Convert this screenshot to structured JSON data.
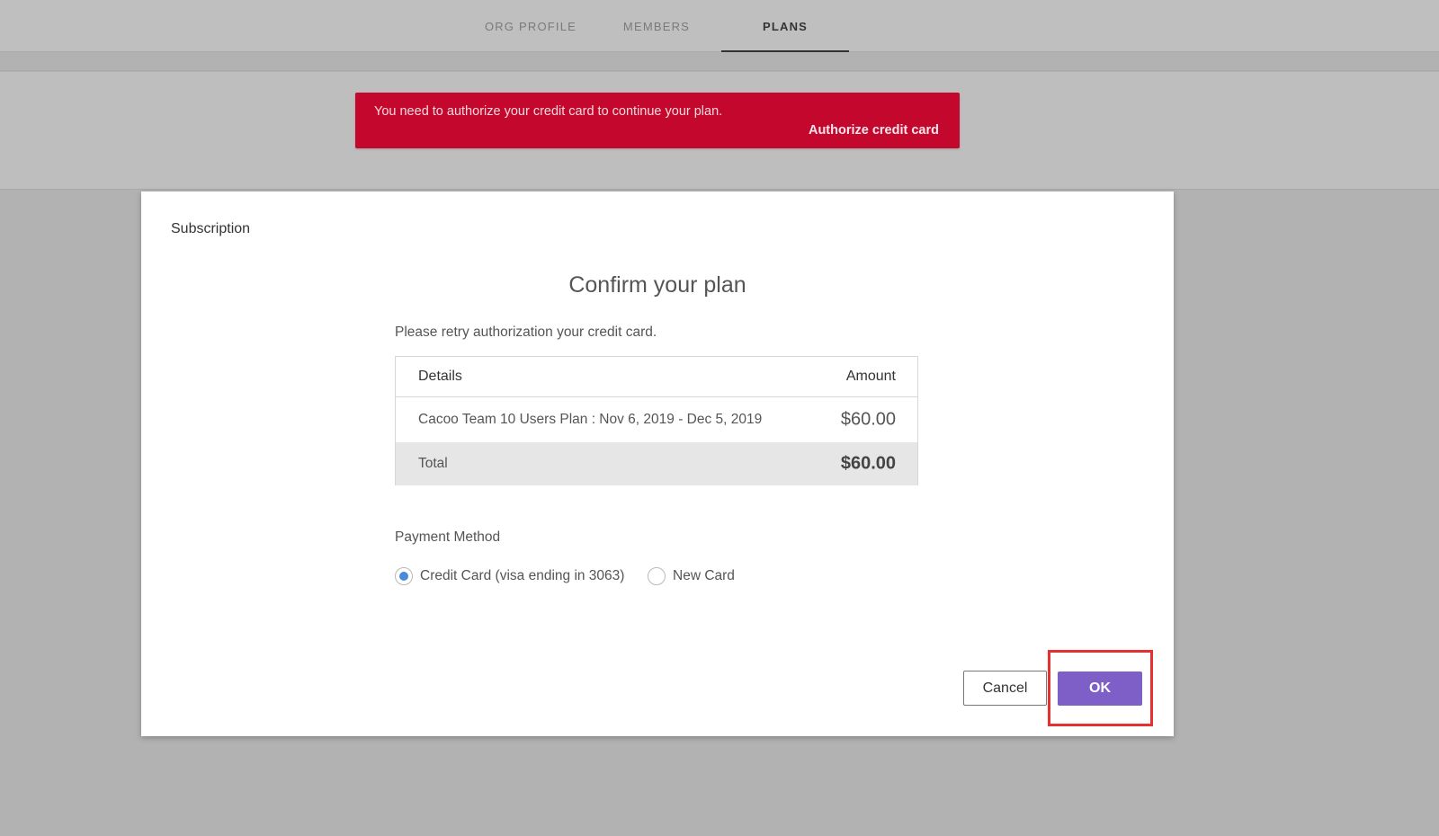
{
  "tabs": [
    {
      "label": "ORG PROFILE",
      "active": false
    },
    {
      "label": "MEMBERS",
      "active": false
    },
    {
      "label": "PLANS",
      "active": true
    }
  ],
  "alert": {
    "message": "You need to authorize your credit card to continue your plan.",
    "action_label": "Authorize credit card",
    "color": "#c4082d"
  },
  "modal": {
    "title": "Subscription",
    "heading": "Confirm your plan",
    "note": "Please retry authorization your credit card.",
    "table": {
      "header": {
        "details": "Details",
        "amount": "Amount"
      },
      "item": {
        "details": "Cacoo Team 10 Users Plan : Nov 6, 2019 - Dec 5, 2019",
        "amount": "$60.00"
      },
      "total": {
        "label": "Total",
        "amount": "$60.00"
      }
    },
    "payment_method": {
      "label": "Payment Method",
      "options": [
        {
          "label": "Credit Card (visa ending in 3063)",
          "selected": true
        },
        {
          "label": "New Card",
          "selected": false
        }
      ]
    },
    "buttons": {
      "cancel": "Cancel",
      "ok": "OK"
    },
    "accent_color": "#7e5ec7",
    "highlight_color": "#e5312f"
  }
}
